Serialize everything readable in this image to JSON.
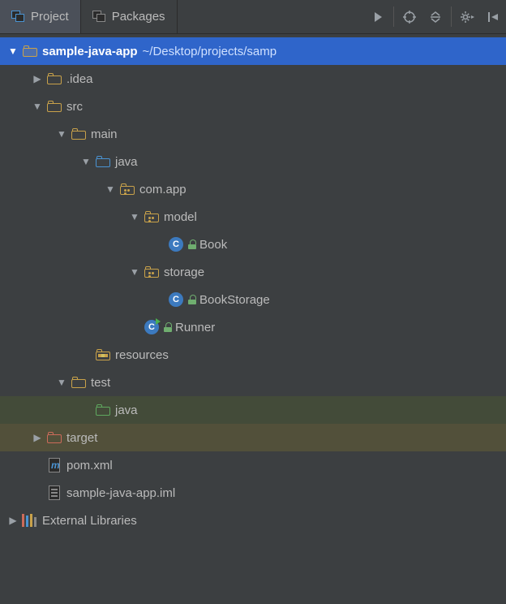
{
  "toolbar": {
    "tabs": [
      {
        "label": "Project",
        "active": true
      },
      {
        "label": "Packages",
        "active": false
      }
    ]
  },
  "tree": [
    {
      "depth": 0,
      "arrow": "down",
      "icon": "proj-folder",
      "label": "sample-java-app",
      "suffix": "~/Desktop/projects/samp",
      "row": "selected-root"
    },
    {
      "depth": 1,
      "arrow": "right",
      "icon": "folder-yellow",
      "label": ".idea"
    },
    {
      "depth": 1,
      "arrow": "down",
      "icon": "folder-yellow",
      "label": "src"
    },
    {
      "depth": 2,
      "arrow": "down",
      "icon": "folder-yellow",
      "label": "main"
    },
    {
      "depth": 3,
      "arrow": "down",
      "icon": "folder-blue",
      "label": "java"
    },
    {
      "depth": 4,
      "arrow": "down",
      "icon": "folder-pkg",
      "label": "com.app"
    },
    {
      "depth": 5,
      "arrow": "down",
      "icon": "folder-pkg",
      "label": "model"
    },
    {
      "depth": 6,
      "arrow": "none",
      "icon": "class",
      "label": "Book",
      "lock": true
    },
    {
      "depth": 5,
      "arrow": "down",
      "icon": "folder-pkg",
      "label": "storage"
    },
    {
      "depth": 6,
      "arrow": "none",
      "icon": "class",
      "label": "BookStorage",
      "lock": true
    },
    {
      "depth": 5,
      "arrow": "none",
      "icon": "class-runner",
      "label": "Runner",
      "lock": true
    },
    {
      "depth": 3,
      "arrow": "none",
      "icon": "folder-res",
      "label": "resources"
    },
    {
      "depth": 2,
      "arrow": "down",
      "icon": "folder-yellow",
      "label": "test"
    },
    {
      "depth": 3,
      "arrow": "none",
      "icon": "folder-green",
      "label": "java",
      "row": "hl-dark"
    },
    {
      "depth": 1,
      "arrow": "right",
      "icon": "folder-red",
      "label": "target",
      "row": "hl-brown"
    },
    {
      "depth": 1,
      "arrow": "none",
      "icon": "file-m",
      "label": "pom.xml"
    },
    {
      "depth": 1,
      "arrow": "none",
      "icon": "file-iml",
      "label": "sample-java-app.iml"
    },
    {
      "depth": 0,
      "arrow": "right",
      "icon": "ext-lib",
      "label": "External Libraries"
    }
  ]
}
